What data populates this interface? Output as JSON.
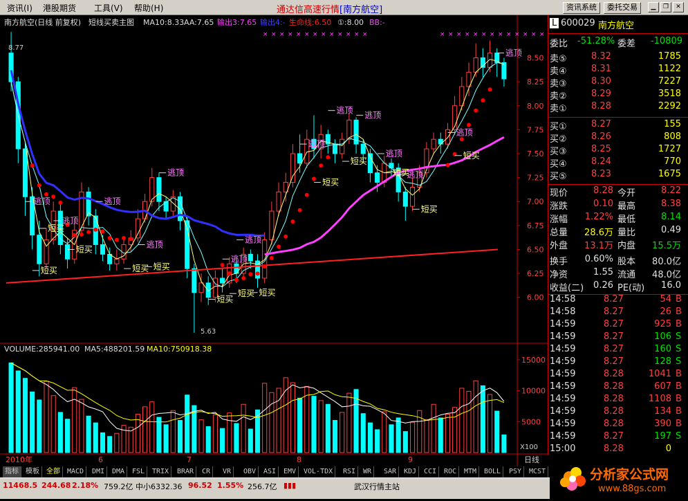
{
  "menu": [
    "资讯(I)",
    "港股期货",
    "工具(V)",
    "帮助(H)"
  ],
  "title_main": "通达信高速行情",
  "title_stock": "[南方航空]",
  "toolbar_buttons": [
    "资讯系统",
    "委托交易"
  ],
  "window_controls": [
    "minimize-icon",
    "restore-icon",
    "close-icon"
  ],
  "chart_header": {
    "name": "南方航空(日线 前复权)",
    "indicator": "短线买卖主图",
    "ma10": "MA10:8.33",
    "aa": "AA:7.65",
    "out3": "输出3:7.65",
    "out4": "输出4:-",
    "life": "生命线:6.50",
    "d1": "①:8.00",
    "bb": "BB:-"
  },
  "volume_header": {
    "volume": "VOLUME:285941.00",
    "ma5": "MA5:488201.59",
    "ma10": "MA10:750918.38"
  },
  "chart_data": {
    "type": "candlestick",
    "price_axis_ticks": [
      "8.50",
      "8.25",
      "8.00",
      "7.75",
      "7.50",
      "7.25",
      "7.00",
      "6.75",
      "6.50",
      "6.25",
      "6.00"
    ],
    "volume_axis_ticks": [
      "15000",
      "10000",
      "5000"
    ],
    "volume_axis_unit": "X100",
    "x_labels": [
      "2010年",
      "6",
      "7",
      "8",
      "9"
    ],
    "period_label": "日线",
    "high_label": "8.77",
    "low_label": "5.63",
    "annotations": [
      {
        "text": "逃顶",
        "x": 3,
        "y": 7.0
      },
      {
        "text": "短买",
        "x": 5,
        "y": 6.72
      },
      {
        "text": "逃顶",
        "x": 7,
        "y": 6.8
      },
      {
        "text": "逃顶",
        "x": 13,
        "y": 7.0
      },
      {
        "text": "短买",
        "x": 9,
        "y": 6.5
      },
      {
        "text": "短买",
        "x": 4,
        "y": 6.28
      },
      {
        "text": "短买",
        "x": 17,
        "y": 6.3
      },
      {
        "text": "逃顶",
        "x": 19,
        "y": 6.55
      },
      {
        "text": "短买",
        "x": 20,
        "y": 6.32
      },
      {
        "text": "逃顶",
        "x": 22,
        "y": 7.3
      },
      {
        "text": "短买",
        "x": 29,
        "y": 5.98
      },
      {
        "text": "短买",
        "x": 32,
        "y": 6.04
      },
      {
        "text": "短买",
        "x": 35,
        "y": 6.05
      },
      {
        "text": "逃顶",
        "x": 31,
        "y": 6.4
      },
      {
        "text": "逃顶",
        "x": 33,
        "y": 6.6
      },
      {
        "text": "逃顶",
        "x": 42,
        "y": 7.6
      },
      {
        "text": "逃顶",
        "x": 46,
        "y": 7.95
      },
      {
        "text": "短买",
        "x": 44,
        "y": 7.2
      },
      {
        "text": "逃顶",
        "x": 50,
        "y": 7.9
      },
      {
        "text": "短买",
        "x": 48,
        "y": 7.42
      },
      {
        "text": "逃顶",
        "x": 53,
        "y": 7.5
      },
      {
        "text": "短买",
        "x": 54,
        "y": 7.3
      },
      {
        "text": "逃顶",
        "x": 56,
        "y": 7.28
      },
      {
        "text": "短买",
        "x": 58,
        "y": 6.92
      },
      {
        "text": "逃顶",
        "x": 63,
        "y": 7.72
      },
      {
        "text": "短买",
        "x": 64,
        "y": 7.48
      },
      {
        "text": "逃顶",
        "x": 70,
        "y": 8.55
      }
    ],
    "candles": [
      [
        8.55,
        8.25,
        8.77,
        8.15
      ],
      [
        8.25,
        7.55,
        8.3,
        7.4
      ],
      [
        7.55,
        7.05,
        7.62,
        6.85
      ],
      [
        7.05,
        6.65,
        7.15,
        6.5
      ],
      [
        6.65,
        6.35,
        6.8,
        6.22
      ],
      [
        6.35,
        6.6,
        6.72,
        6.3
      ],
      [
        6.6,
        6.9,
        7.0,
        6.55
      ],
      [
        6.9,
        6.55,
        6.98,
        6.45
      ],
      [
        6.55,
        6.4,
        6.62,
        6.3
      ],
      [
        6.4,
        6.7,
        6.82,
        6.35
      ],
      [
        6.7,
        7.1,
        7.2,
        6.65
      ],
      [
        7.1,
        6.85,
        7.15,
        6.75
      ],
      [
        6.85,
        6.55,
        6.92,
        6.45
      ],
      [
        6.55,
        6.45,
        6.65,
        6.38
      ],
      [
        6.45,
        6.35,
        6.52,
        6.28
      ],
      [
        6.35,
        6.4,
        6.5,
        6.28
      ],
      [
        6.4,
        6.55,
        6.62,
        6.35
      ],
      [
        6.55,
        6.62,
        6.7,
        6.48
      ],
      [
        6.62,
        6.82,
        6.92,
        6.58
      ],
      [
        6.82,
        7.0,
        7.08,
        6.78
      ],
      [
        7.0,
        7.25,
        7.35,
        6.95
      ],
      [
        7.25,
        7.0,
        7.3,
        6.9
      ],
      [
        7.0,
        6.9,
        7.05,
        6.82
      ],
      [
        6.9,
        7.05,
        7.12,
        6.85
      ],
      [
        7.05,
        6.8,
        7.1,
        6.7
      ],
      [
        6.8,
        6.3,
        6.85,
        6.2
      ],
      [
        6.3,
        6.05,
        6.35,
        5.63
      ],
      [
        6.05,
        6.15,
        6.25,
        5.95
      ],
      [
        6.15,
        6.0,
        6.22,
        5.92
      ],
      [
        6.0,
        6.2,
        6.28,
        5.95
      ],
      [
        6.2,
        6.15,
        6.3,
        6.05
      ],
      [
        6.15,
        6.35,
        6.42,
        6.1
      ],
      [
        6.35,
        6.25,
        6.42,
        6.15
      ],
      [
        6.25,
        6.45,
        6.52,
        6.2
      ],
      [
        6.45,
        6.38,
        6.5,
        6.3
      ],
      [
        6.38,
        6.2,
        6.45,
        6.1
      ],
      [
        6.2,
        6.6,
        6.68,
        6.15
      ],
      [
        6.6,
        6.9,
        7.0,
        6.55
      ],
      [
        6.9,
        7.1,
        7.2,
        6.85
      ],
      [
        7.1,
        7.2,
        7.3,
        7.0
      ],
      [
        7.2,
        7.5,
        7.6,
        7.15
      ],
      [
        7.5,
        7.4,
        7.7,
        7.3
      ],
      [
        7.4,
        7.65,
        7.75,
        7.35
      ],
      [
        7.65,
        7.55,
        7.9,
        7.45
      ],
      [
        7.55,
        7.7,
        7.8,
        7.45
      ],
      [
        7.7,
        7.6,
        7.75,
        7.5
      ],
      [
        7.6,
        7.5,
        7.65,
        7.4
      ],
      [
        7.5,
        7.65,
        7.72,
        7.45
      ],
      [
        7.65,
        7.85,
        7.92,
        7.6
      ],
      [
        7.85,
        7.6,
        7.88,
        7.5
      ],
      [
        7.6,
        7.5,
        7.65,
        7.4
      ],
      [
        7.5,
        7.3,
        7.55,
        7.2
      ],
      [
        7.3,
        7.2,
        7.38,
        7.1
      ],
      [
        7.2,
        7.4,
        7.48,
        7.15
      ],
      [
        7.4,
        7.35,
        7.45,
        7.25
      ],
      [
        7.35,
        7.1,
        7.4,
        7.0
      ],
      [
        7.1,
        6.95,
        7.15,
        6.8
      ],
      [
        6.95,
        7.15,
        7.25,
        6.9
      ],
      [
        7.15,
        7.3,
        7.38,
        7.1
      ],
      [
        7.3,
        7.55,
        7.62,
        7.25
      ],
      [
        7.55,
        7.65,
        7.72,
        7.5
      ],
      [
        7.65,
        7.6,
        7.72,
        7.5
      ],
      [
        7.6,
        7.75,
        7.82,
        7.55
      ],
      [
        7.75,
        8.0,
        8.1,
        7.7
      ],
      [
        8.0,
        8.2,
        8.3,
        7.95
      ],
      [
        8.2,
        8.35,
        8.45,
        8.1
      ],
      [
        8.35,
        8.5,
        8.65,
        8.3
      ],
      [
        8.5,
        8.4,
        8.6,
        8.3
      ],
      [
        8.4,
        8.55,
        8.68,
        8.35
      ],
      [
        8.55,
        8.45,
        8.6,
        8.3
      ],
      [
        8.45,
        8.28,
        8.5,
        8.2
      ]
    ],
    "volumes": [
      14500,
      13200,
      12000,
      9800,
      8500,
      11500,
      9200,
      6500,
      5400,
      10500,
      8600,
      5900,
      4800,
      3200,
      2600,
      3100,
      4400,
      4100,
      6200,
      7400,
      8200,
      5700,
      4500,
      6800,
      5200,
      9300,
      7600,
      5300,
      4200,
      6100,
      3900,
      6400,
      4700,
      7800,
      3800,
      6900,
      11200,
      9700,
      10400,
      12100,
      11300,
      8800,
      10700,
      9100,
      8400,
      7800,
      5200,
      6500,
      9600,
      10200,
      6300,
      4800,
      3700,
      6600,
      4500,
      5600,
      3400,
      4900,
      6800,
      5300,
      7800,
      5600,
      6200,
      7300,
      10400,
      9900,
      11600,
      10800,
      9400,
      6700,
      2860
    ]
  },
  "quote": {
    "code": "600029",
    "name": "南方航空",
    "weibi_label": "委比",
    "weibi_value": "-51.28%",
    "weicha_label": "委差",
    "weicha_value": "-10809",
    "sell": [
      {
        "label": "卖⑤",
        "price": "8.32",
        "vol": "1785"
      },
      {
        "label": "卖④",
        "price": "8.31",
        "vol": "1122"
      },
      {
        "label": "卖③",
        "price": "8.30",
        "vol": "7227"
      },
      {
        "label": "卖②",
        "price": "8.29",
        "vol": "3518"
      },
      {
        "label": "卖①",
        "price": "8.28",
        "vol": "2292"
      }
    ],
    "buy": [
      {
        "label": "买①",
        "price": "8.27",
        "vol": "155"
      },
      {
        "label": "买②",
        "price": "8.26",
        "vol": "808"
      },
      {
        "label": "买③",
        "price": "8.25",
        "vol": "1727"
      },
      {
        "label": "买④",
        "price": "8.24",
        "vol": "770"
      },
      {
        "label": "买⑤",
        "price": "8.23",
        "vol": "1675"
      }
    ],
    "stats": [
      {
        "l1": "现价",
        "v1": "8.28",
        "c1": "up",
        "l2": "今开",
        "v2": "8.22",
        "c2": "up"
      },
      {
        "l1": "涨跌",
        "v1": "0.10",
        "c1": "up",
        "l2": "最高",
        "v2": "8.38",
        "c2": "up"
      },
      {
        "l1": "涨幅",
        "v1": "1.22%",
        "c1": "up",
        "l2": "最低",
        "v2": "8.14",
        "c2": "dn"
      },
      {
        "l1": "总量",
        "v1": "28.6万",
        "c1": "yl",
        "l2": "量比",
        "v2": "0.49",
        "c2": "wh"
      },
      {
        "l1": "外盘",
        "v1": "13.1万",
        "c1": "up",
        "l2": "内盘",
        "v2": "15.5万",
        "c2": "dn"
      },
      {
        "l1": "换手",
        "v1": "0.60%",
        "c1": "wh",
        "l2": "股本",
        "v2": "80.0亿",
        "c2": "wh"
      },
      {
        "l1": "净资",
        "v1": "1.55",
        "c1": "wh",
        "l2": "流通",
        "v2": "48.0亿",
        "c2": "wh"
      },
      {
        "l1": "收益(二)",
        "v1": "0.26",
        "c1": "wh",
        "l2": "PE(动)",
        "v2": "16.0",
        "c2": "wh"
      }
    ],
    "ticks": [
      {
        "time": "14:58",
        "price": "8.27",
        "vol": "54",
        "side": "B"
      },
      {
        "time": "14:58",
        "price": "8.27",
        "vol": "26",
        "side": "B"
      },
      {
        "time": "14:59",
        "price": "8.27",
        "vol": "925",
        "side": "B"
      },
      {
        "time": "14:59",
        "price": "8.27",
        "vol": "106",
        "side": "S"
      },
      {
        "time": "14:59",
        "price": "8.27",
        "vol": "160",
        "side": "S"
      },
      {
        "time": "14:59",
        "price": "8.27",
        "vol": "128",
        "side": "S"
      },
      {
        "time": "14:59",
        "price": "8.28",
        "vol": "1041",
        "side": "B"
      },
      {
        "time": "14:59",
        "price": "8.28",
        "vol": "607",
        "side": "B"
      },
      {
        "time": "14:59",
        "price": "8.28",
        "vol": "1108",
        "side": "B"
      },
      {
        "time": "14:59",
        "price": "8.28",
        "vol": "134",
        "side": "B"
      },
      {
        "time": "14:59",
        "price": "8.28",
        "vol": "390",
        "side": "B"
      },
      {
        "time": "14:59",
        "price": "8.27",
        "vol": "197",
        "side": "S"
      },
      {
        "time": "15:00",
        "price": "8.28",
        "vol": "0",
        "side": ""
      }
    ]
  },
  "tabs": [
    "指标",
    "模板",
    "全部",
    "MACD",
    "DMI",
    "DMA",
    "FSL",
    "TRIX",
    "BRAR",
    "CR",
    "VR",
    "OBV",
    "ASI",
    "EMV",
    "VOL-TDX",
    "RSI",
    "WR",
    "SAR",
    "KDJ",
    "CCI",
    "ROC",
    "MTM",
    "BOLL",
    "PSY",
    "MCST"
  ],
  "status": {
    "s1": "11468.5",
    "s2": "244.68",
    "s3": "2.18%",
    "s4": "759.2亿",
    "s5": "中小6332.36",
    "s6": "96.52",
    "s7": "1.55%",
    "s8": "256.7亿",
    "s9": "武汉行情主站"
  },
  "logo": {
    "text": "分析家公式网",
    "url": "www.88gs.com"
  },
  "colors": {
    "up": "#ff4040",
    "down": "#00ffff",
    "ma_blue": "#3030ff",
    "ma_magenta": "#ff40ff",
    "ma_red": "#ff2020",
    "life_dots": "#ff0000"
  }
}
